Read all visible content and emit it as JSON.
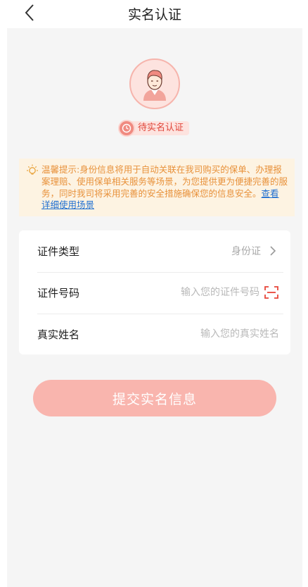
{
  "nav": {
    "title": "实名认证"
  },
  "status": {
    "badge_label": "待实名认证"
  },
  "tip": {
    "text": "温馨提示:身份信息将用于自动关联在我司购买的保单、办理报案理赔、使用保单相关服务等场景，为您提供更为便捷完善的服务，同时我司将采用完善的安全措施确保您的信息安全。",
    "link_label": "查看详细使用场景"
  },
  "form": {
    "id_type": {
      "label": "证件类型",
      "value": "身份证"
    },
    "id_number": {
      "label": "证件号码",
      "placeholder": "输入您的证件号码"
    },
    "real_name": {
      "label": "真实姓名",
      "placeholder": "输入您的真实姓名"
    }
  },
  "submit_label": "提交实名信息",
  "colors": {
    "accent": "#f08a80",
    "tip_text": "#e8913a",
    "link": "#1f6fd1",
    "submit_bg": "#f9b5ae"
  }
}
